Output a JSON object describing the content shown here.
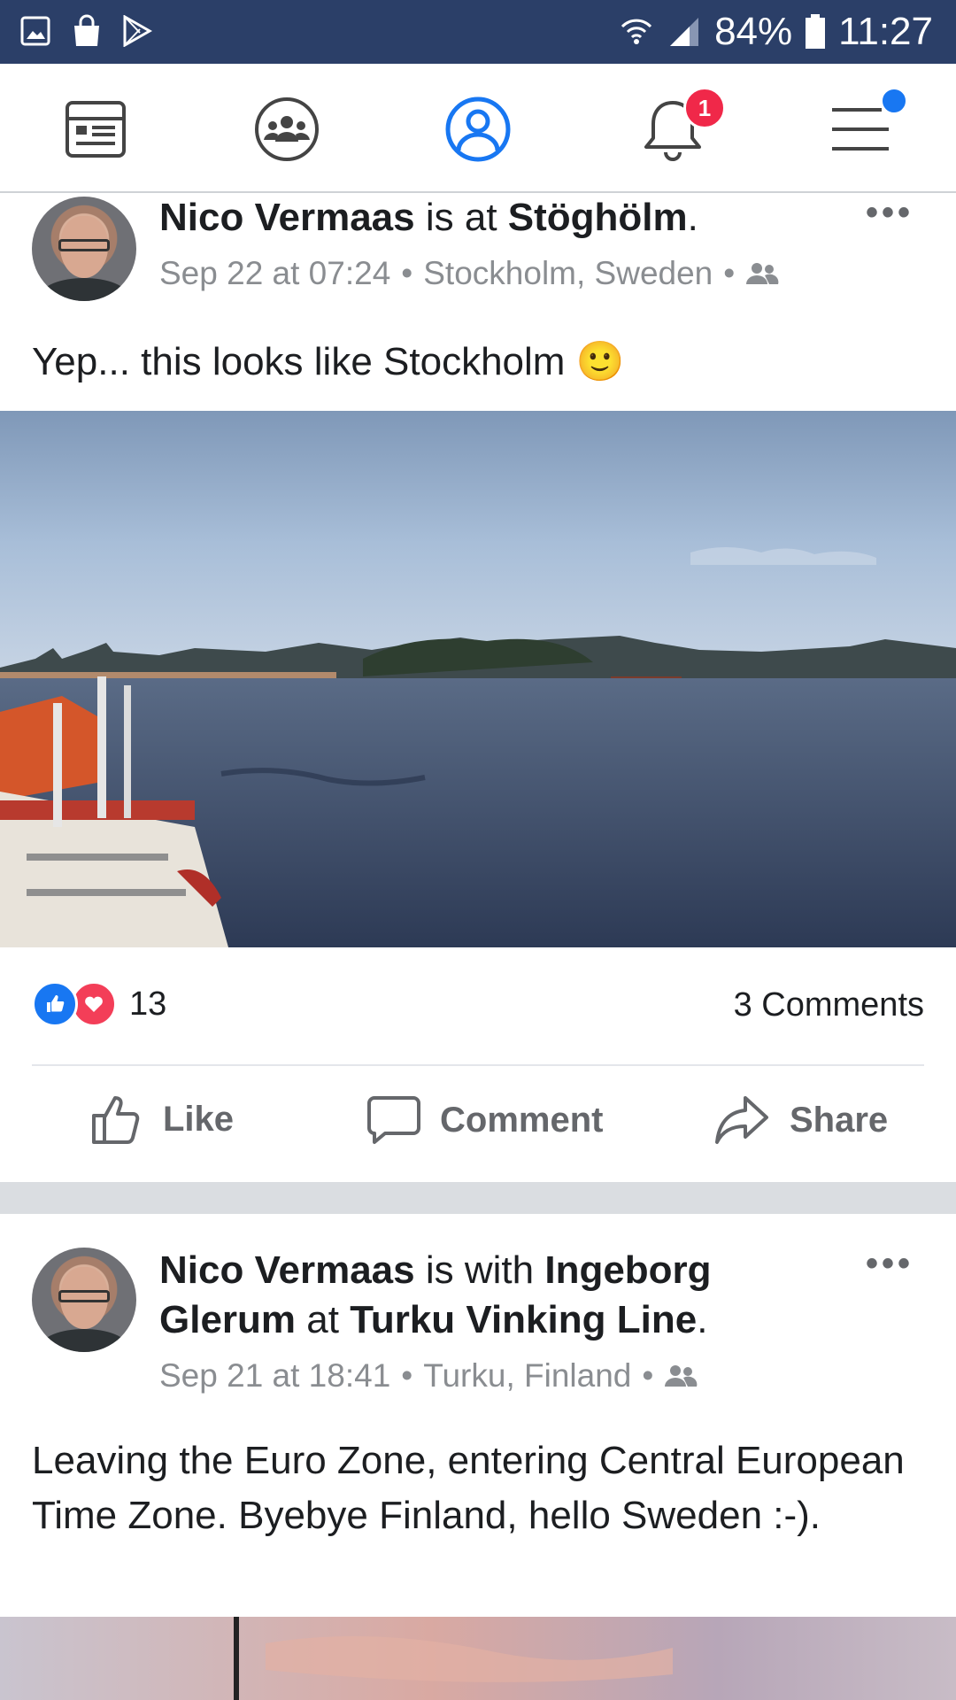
{
  "status_bar": {
    "battery": "84%",
    "time": "11:27"
  },
  "nav": {
    "items": [
      {
        "name": "news-feed"
      },
      {
        "name": "groups"
      },
      {
        "name": "profile"
      },
      {
        "name": "notifications",
        "badge": "1"
      },
      {
        "name": "menu"
      }
    ],
    "active_color": "#1877f2",
    "badge_color": "#f02849"
  },
  "posts": [
    {
      "author": "Nico Vermaas",
      "verb": "is at",
      "place": "Stöghölm",
      "end": ".",
      "timestamp": "Sep 22 at 07:24",
      "location": "Stockholm, Sweden",
      "text": "Yep... this looks like Stockholm",
      "emoji": "🙂",
      "reaction_count": "13",
      "comments": "3 Comments",
      "actions": {
        "like": "Like",
        "comment": "Comment",
        "share": "Share"
      }
    },
    {
      "author": "Nico Vermaas",
      "verb": "is with",
      "with": "Ingeborg Glerum",
      "at": "at",
      "place": "Turku Vinking Line",
      "end": ".",
      "timestamp": "Sep 21 at 18:41",
      "location": "Turku, Finland",
      "text": "Leaving the Euro Zone, entering Central European Time Zone. Byebye Finland, hello Sweden :-)."
    }
  ],
  "separator": "•"
}
